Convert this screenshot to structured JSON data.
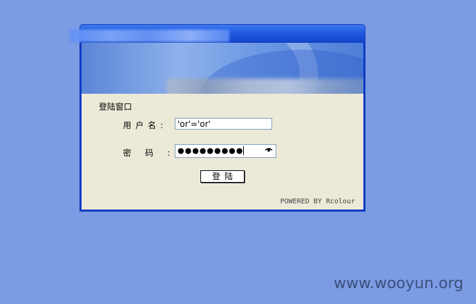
{
  "window": {
    "title": "",
    "section_title": "登陆窗口",
    "username_label": "用户名:",
    "username_value": "'or'='or'",
    "password_label": "密码:",
    "password_value": "●●●●●●●●●",
    "login_button": "登陆",
    "powered_by": "POWERED BY Rcolour"
  },
  "watermark": "www.wooyun.org",
  "colors": {
    "page_bg": "#7b9be3",
    "titlebar": "#1d56dd",
    "panel_bg": "#ece9d8"
  }
}
